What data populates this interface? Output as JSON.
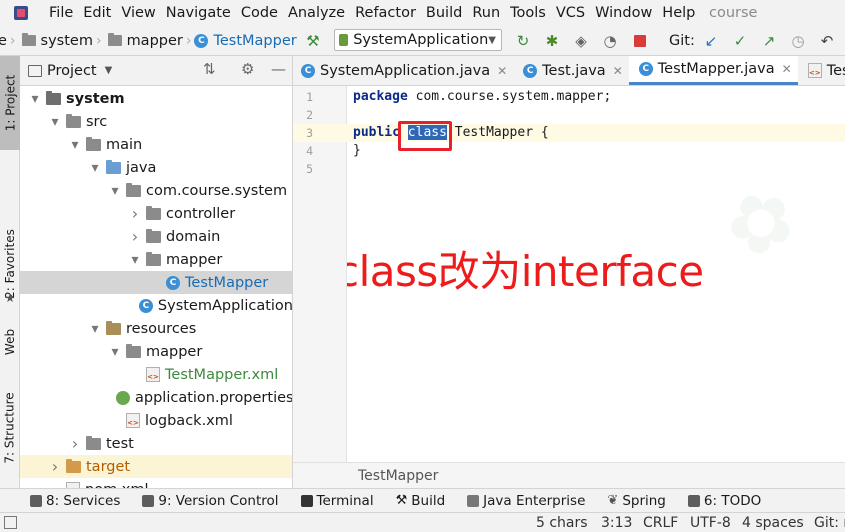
{
  "menu": {
    "items": [
      "File",
      "Edit",
      "View",
      "Navigate",
      "Code",
      "Analyze",
      "Refactor",
      "Build",
      "Run",
      "Tools",
      "VCS",
      "Window",
      "Help"
    ],
    "project_name": "course"
  },
  "toolbar": {
    "breadcrumb": [
      "e",
      "system",
      "mapper",
      "TestMapper"
    ],
    "run_config": "SystemApplication",
    "git_label": "Git:"
  },
  "left_strip": {
    "project_tab": "1: Project",
    "favorites_tab": "2: Favorites",
    "web_tab": "Web",
    "structure_tab": "7: Structure"
  },
  "project_panel": {
    "title": "Project",
    "tree": [
      {
        "label": "system",
        "depth": 0,
        "arrow": "down",
        "icon": "module-folder",
        "bold": true
      },
      {
        "label": "src",
        "depth": 1,
        "arrow": "down",
        "icon": "folder"
      },
      {
        "label": "main",
        "depth": 2,
        "arrow": "down",
        "icon": "folder"
      },
      {
        "label": "java",
        "depth": 3,
        "arrow": "down",
        "icon": "source-folder"
      },
      {
        "label": "com.course.system",
        "depth": 4,
        "arrow": "down",
        "icon": "package"
      },
      {
        "label": "controller",
        "depth": 5,
        "arrow": "right",
        "icon": "package"
      },
      {
        "label": "domain",
        "depth": 5,
        "arrow": "right",
        "icon": "package"
      },
      {
        "label": "mapper",
        "depth": 5,
        "arrow": "down",
        "icon": "package"
      },
      {
        "label": "TestMapper",
        "depth": 6,
        "arrow": "",
        "icon": "class",
        "selected": true
      },
      {
        "label": "SystemApplication",
        "depth": 5,
        "arrow": "",
        "icon": "spring-class"
      },
      {
        "label": "resources",
        "depth": 3,
        "arrow": "down",
        "icon": "resources-folder"
      },
      {
        "label": "mapper",
        "depth": 4,
        "arrow": "down",
        "icon": "folder"
      },
      {
        "label": "TestMapper.xml",
        "depth": 5,
        "arrow": "",
        "icon": "xml"
      },
      {
        "label": "application.properties",
        "depth": 4,
        "arrow": "",
        "icon": "properties"
      },
      {
        "label": "logback.xml",
        "depth": 4,
        "arrow": "",
        "icon": "xml"
      },
      {
        "label": "test",
        "depth": 2,
        "arrow": "right",
        "icon": "folder"
      },
      {
        "label": "target",
        "depth": 1,
        "arrow": "right",
        "icon": "excluded-folder",
        "target": true
      },
      {
        "label": "pom.xml",
        "depth": 1,
        "arrow": "",
        "icon": "maven"
      }
    ]
  },
  "editor_tabs": [
    {
      "label": "SystemApplication.java",
      "active": false
    },
    {
      "label": "Test.java",
      "active": false
    },
    {
      "label": "TestMapper.java",
      "active": true
    },
    {
      "label": "TestMapper.xml",
      "active": false
    }
  ],
  "editor": {
    "line_numbers": [
      "1",
      "2",
      "3",
      "4",
      "5"
    ],
    "code": {
      "line1_kw": "package",
      "line1_rest": " com.course.system.mapper;",
      "line3_kw": "public",
      "line3_selected": "class",
      "line3_rest": " TestMapper {",
      "line4": "}"
    },
    "annotation": "class改为interface",
    "footer_breadcrumb": "TestMapper"
  },
  "tool_windows": [
    {
      "label": "8: Services",
      "icon": "services-icon"
    },
    {
      "label": "9: Version Control",
      "icon": "vcs-icon"
    },
    {
      "label": "Terminal",
      "icon": "terminal-icon"
    },
    {
      "label": "Build",
      "icon": "hammer-icon"
    },
    {
      "label": "Java Enterprise",
      "icon": "java-enterprise-icon"
    },
    {
      "label": "Spring",
      "icon": "spring-icon"
    },
    {
      "label": "6: TODO",
      "icon": "todo-icon"
    }
  ],
  "status": {
    "chars": "5 chars",
    "position": "3:13",
    "line_sep": "CRLF",
    "encoding": "UTF-8",
    "indent": "4 spaces",
    "git": "Git: r"
  },
  "colors": {
    "selection": "#2f66b5",
    "annotation_red": "#ee1b1b",
    "active_tab_underline": "#4a86c7",
    "keyword": "#0a2b88"
  }
}
